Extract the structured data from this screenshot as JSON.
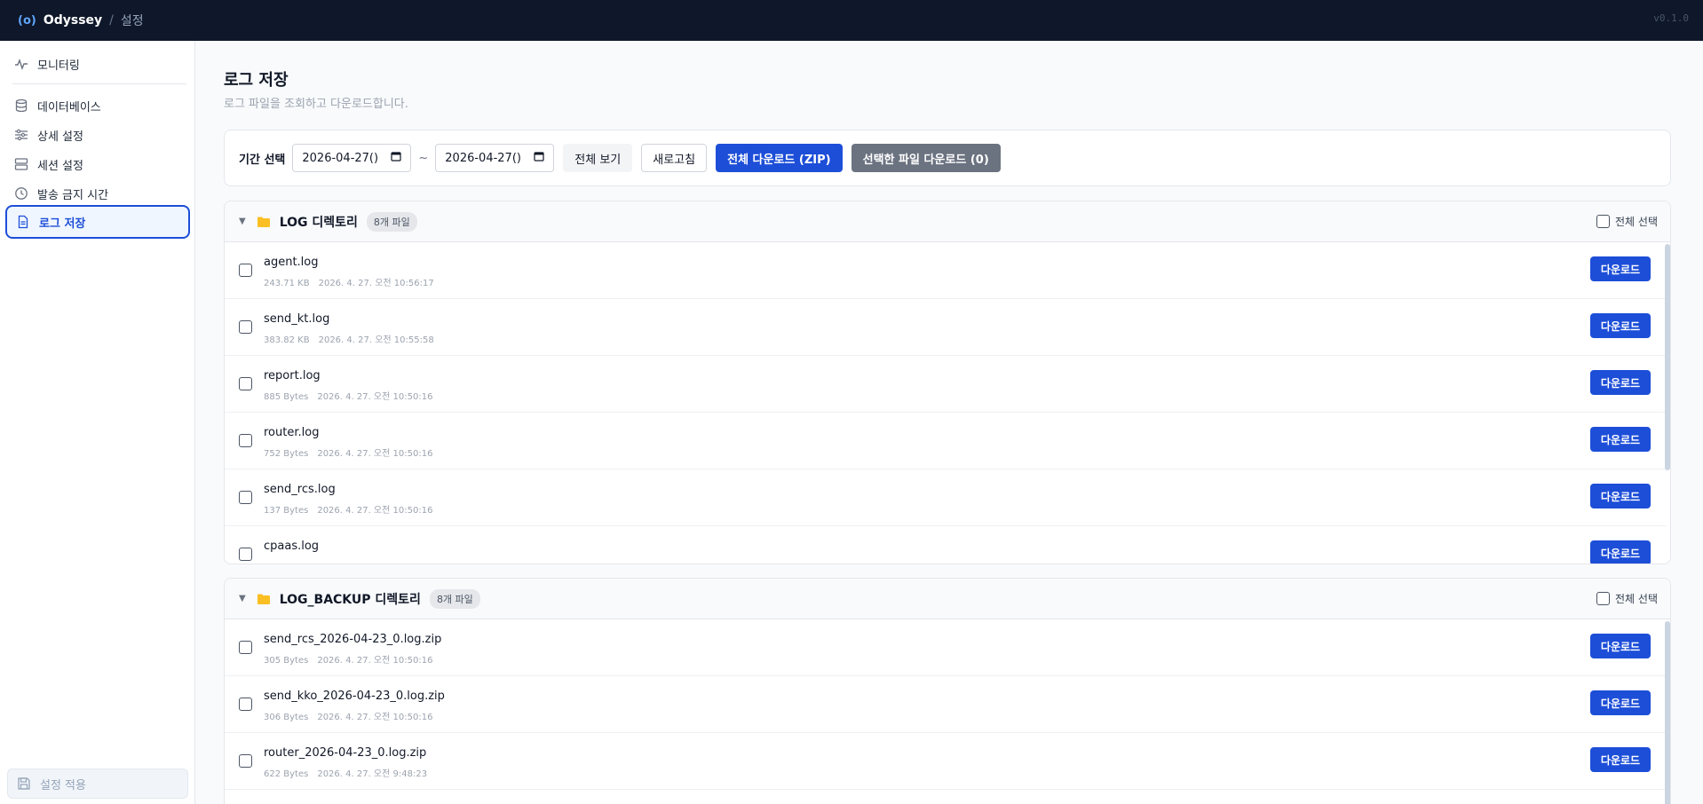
{
  "topbar": {
    "logo": "(o)",
    "app_name": "Odyssey",
    "separator": "/",
    "breadcrumb": "설정",
    "version": "v0.1.0"
  },
  "sidebar": {
    "items": [
      {
        "label": "모니터링",
        "icon": "activity-icon"
      },
      {
        "label": "데이터베이스",
        "icon": "database-icon"
      },
      {
        "label": "상세 설정",
        "icon": "sliders-icon"
      },
      {
        "label": "세션 설정",
        "icon": "server-icon"
      },
      {
        "label": "발송 금지 시간",
        "icon": "clock-icon"
      },
      {
        "label": "로그 저장",
        "icon": "file-icon",
        "active": true
      }
    ],
    "apply_label": "설정 적용"
  },
  "page": {
    "title": "로그 저장",
    "subtitle": "로그 파일을 조회하고 다운로드합니다."
  },
  "filter": {
    "label": "기간 선택",
    "start_date": "2026-04-27()",
    "separator": "~",
    "end_date": "2026-04-27()",
    "view_all": "전체 보기",
    "refresh": "새로고침",
    "download_all": "전체 다운로드 (ZIP)",
    "download_selected": "선택한 파일 다운로드 (0)"
  },
  "directories": [
    {
      "name": "LOG 디렉토리",
      "count": "8개 파일",
      "select_all": "전체 선택",
      "files": [
        {
          "name": "agent.log",
          "size": "243.71 KB",
          "date": "2026. 4. 27. 오전 10:56:17"
        },
        {
          "name": "send_kt.log",
          "size": "383.82 KB",
          "date": "2026. 4. 27. 오전 10:55:58"
        },
        {
          "name": "report.log",
          "size": "885 Bytes",
          "date": "2026. 4. 27. 오전 10:50:16"
        },
        {
          "name": "router.log",
          "size": "752 Bytes",
          "date": "2026. 4. 27. 오전 10:50:16"
        },
        {
          "name": "send_rcs.log",
          "size": "137 Bytes",
          "date": "2026. 4. 27. 오전 10:50:16"
        },
        {
          "name": "cpaas.log",
          "size": "",
          "date": ""
        }
      ]
    },
    {
      "name": "LOG_BACKUP 디렉토리",
      "count": "8개 파일",
      "select_all": "전체 선택",
      "files": [
        {
          "name": "send_rcs_2026-04-23_0.log.zip",
          "size": "305 Bytes",
          "date": "2026. 4. 27. 오전 10:50:16"
        },
        {
          "name": "send_kko_2026-04-23_0.log.zip",
          "size": "306 Bytes",
          "date": "2026. 4. 27. 오전 10:50:16"
        },
        {
          "name": "router_2026-04-23_0.log.zip",
          "size": "622 Bytes",
          "date": "2026. 4. 27. 오전 9:48:23"
        }
      ]
    }
  ],
  "download_label": "다운로드"
}
